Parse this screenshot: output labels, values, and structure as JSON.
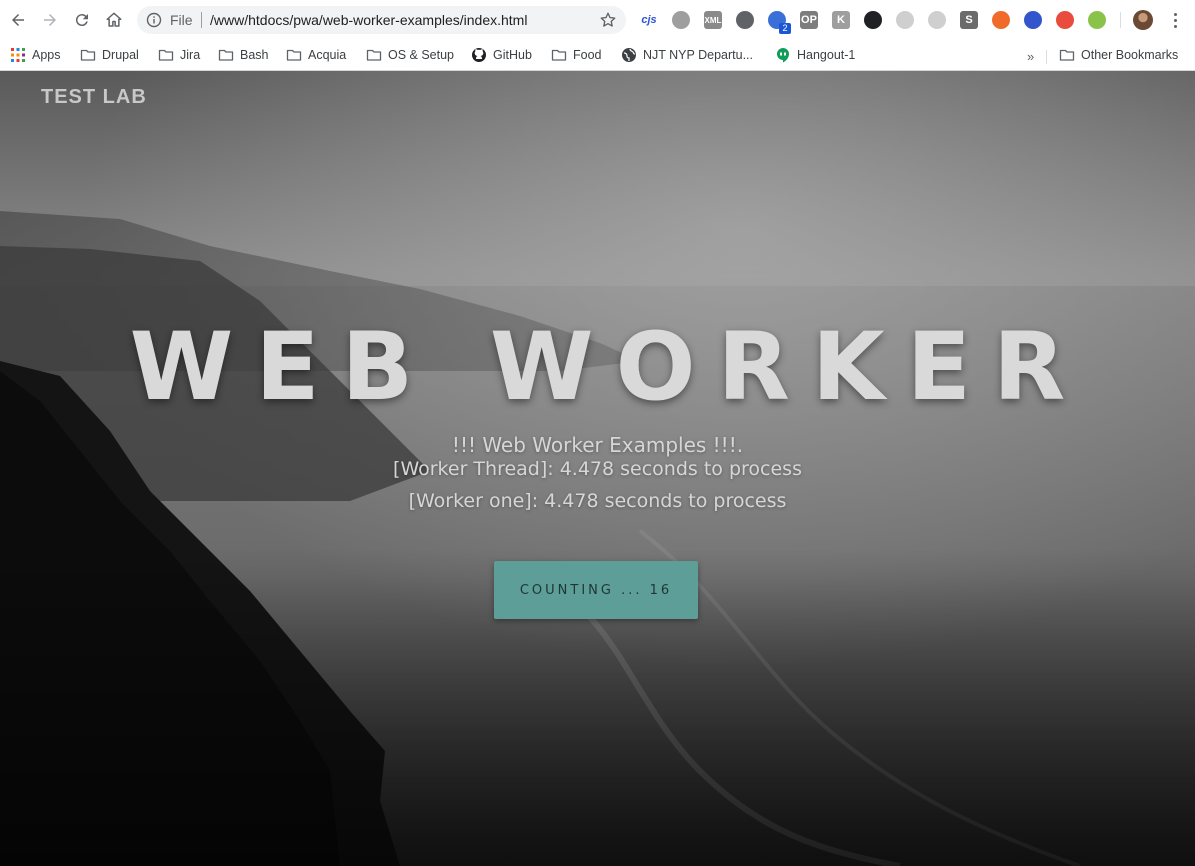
{
  "browser": {
    "omnibox": {
      "scheme_label": "File",
      "url": "/www/htdocs/pwa/web-worker-examples/index.html"
    },
    "extensions": [
      {
        "name": "cjs-extension-icon",
        "label": "cjs",
        "color": "#2c55d6"
      },
      {
        "name": "opera-extension-icon",
        "label": "",
        "color": "#9e9e9e"
      },
      {
        "name": "xml-extension-icon",
        "label": "XML",
        "color": "#8a8a8a"
      },
      {
        "name": "settings-extension-icon",
        "label": "",
        "color": "#5f6368"
      },
      {
        "name": "ladybug-extension-icon",
        "label": "",
        "color": "#3b6fd8"
      },
      {
        "name": "op-extension-icon",
        "label": "OP",
        "color": "#7d7d7d"
      },
      {
        "name": "k-extension-icon",
        "label": "K",
        "color": "#9e9e9e"
      },
      {
        "name": "search-extension-icon",
        "label": "",
        "color": "#202124"
      },
      {
        "name": "react-extension-icon",
        "label": "",
        "color": "#cfcfcf"
      },
      {
        "name": "target-extension-icon",
        "label": "",
        "color": "#cfcfcf"
      },
      {
        "name": "skype-extension-icon",
        "label": "S",
        "color": "#6b6b6b"
      },
      {
        "name": "lifebuoy-extension-icon",
        "label": "",
        "color": "#f06a2a"
      },
      {
        "name": "bookmark-extension-icon",
        "label": "",
        "color": "#3355cc"
      },
      {
        "name": "nbc-extension-icon",
        "label": "",
        "color": "#e94b3c"
      },
      {
        "name": "pin-extension-icon",
        "label": "",
        "color": "#8bc34a"
      }
    ],
    "extension_badge": "2",
    "bookmarks": [
      {
        "label": "Apps",
        "icon": "apps-grid-icon"
      },
      {
        "label": "Drupal",
        "icon": "folder-icon"
      },
      {
        "label": "Jira",
        "icon": "folder-icon"
      },
      {
        "label": "Bash",
        "icon": "folder-icon"
      },
      {
        "label": "Acquia",
        "icon": "folder-icon"
      },
      {
        "label": "OS & Setup",
        "icon": "folder-icon"
      },
      {
        "label": "GitHub",
        "icon": "github-icon"
      },
      {
        "label": "Food",
        "icon": "folder-icon"
      },
      {
        "label": "NJT NYP Departu...",
        "icon": "globe-icon"
      },
      {
        "label": "Hangout-1",
        "icon": "hangouts-icon"
      }
    ],
    "bookmarks_more": "»",
    "other_bookmarks": "Other Bookmarks"
  },
  "page": {
    "brand": "TEST LAB",
    "title": "WEB WORKER",
    "subtitle": "!!! Web Worker Examples !!!.",
    "worker_thread_line": "[Worker Thread]: 4.478 seconds to process",
    "worker_one_line": "[Worker one]: 4.478 seconds to process",
    "counter_button": "COUNTING ... 16",
    "colors": {
      "button_bg": "#5d9e98",
      "button_text": "#1f3634",
      "text": "#d6d6d6"
    }
  }
}
